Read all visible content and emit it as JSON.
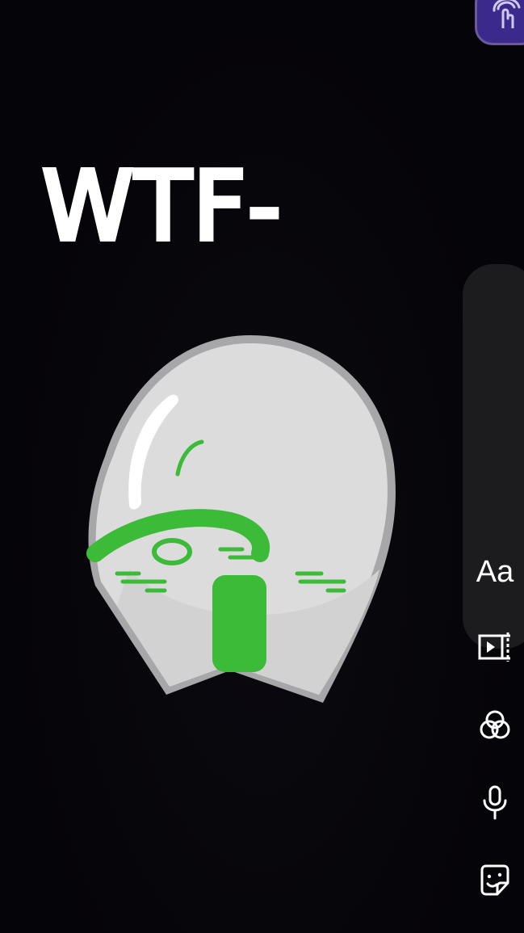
{
  "story_editor": {
    "caption_text": "WTF-",
    "sticker_name": "bald-head-green-face-sticker",
    "accent_color": "#3cbb38",
    "badge_color": "#3b2a8c",
    "toolbar": {
      "items": [
        {
          "label": "Aa",
          "icon": "text-icon"
        },
        {
          "label": "",
          "icon": "trim-video-icon"
        },
        {
          "label": "",
          "icon": "filters-icon"
        },
        {
          "label": "",
          "icon": "microphone-icon"
        },
        {
          "label": "",
          "icon": "sticker-icon"
        }
      ]
    }
  }
}
